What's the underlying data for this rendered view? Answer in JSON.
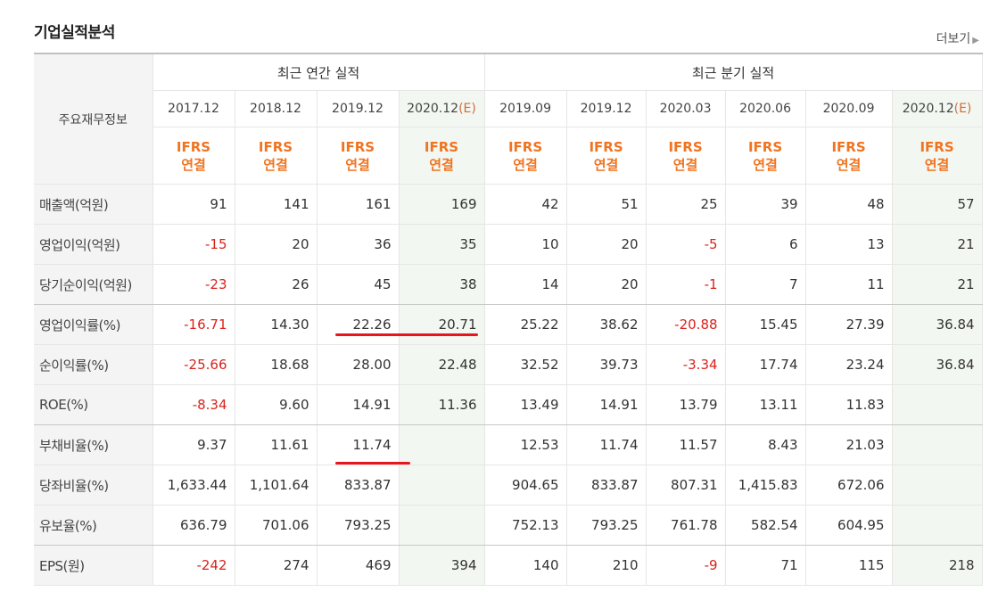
{
  "section_title": "기업실적분석",
  "more_link": "더보기",
  "header": {
    "row_header": "주요재무정보",
    "annual_group": "최근 연간 실적",
    "quarterly_group": "최근 분기 실적",
    "annual_dates": [
      "2017.12",
      "2018.12",
      "2019.12",
      "2020.12"
    ],
    "quarterly_dates": [
      "2019.09",
      "2019.12",
      "2020.03",
      "2020.06",
      "2020.09",
      "2020.12"
    ],
    "estimate_mark": "(E)",
    "ifrs_line1": "IFRS",
    "ifrs_line2": "연결"
  },
  "rows": [
    {
      "label": "매출액(억원)",
      "values": [
        "91",
        "141",
        "161",
        "169",
        "42",
        "51",
        "25",
        "39",
        "48",
        "57"
      ]
    },
    {
      "label": "영업이익(억원)",
      "values": [
        "-15",
        "20",
        "36",
        "35",
        "10",
        "20",
        "-5",
        "6",
        "13",
        "21"
      ]
    },
    {
      "label": "당기순이익(억원)",
      "values": [
        "-23",
        "26",
        "45",
        "38",
        "14",
        "20",
        "-1",
        "7",
        "11",
        "21"
      ]
    },
    {
      "label": "영업이익률(%)",
      "values": [
        "-16.71",
        "14.30",
        "22.26",
        "20.71",
        "25.22",
        "38.62",
        "-20.88",
        "15.45",
        "27.39",
        "36.84"
      ]
    },
    {
      "label": "순이익률(%)",
      "values": [
        "-25.66",
        "18.68",
        "28.00",
        "22.48",
        "32.52",
        "39.73",
        "-3.34",
        "17.74",
        "23.24",
        "36.84"
      ]
    },
    {
      "label": "ROE(%)",
      "values": [
        "-8.34",
        "9.60",
        "14.91",
        "11.36",
        "13.49",
        "14.91",
        "13.79",
        "13.11",
        "11.83",
        ""
      ]
    },
    {
      "label": "부채비율(%)",
      "values": [
        "9.37",
        "11.61",
        "11.74",
        "",
        "12.53",
        "11.74",
        "11.57",
        "8.43",
        "21.03",
        ""
      ]
    },
    {
      "label": "당좌비율(%)",
      "values": [
        "1,633.44",
        "1,101.64",
        "833.87",
        "",
        "904.65",
        "833.87",
        "807.31",
        "1,415.83",
        "672.06",
        ""
      ]
    },
    {
      "label": "유보율(%)",
      "values": [
        "636.79",
        "701.06",
        "793.25",
        "",
        "752.13",
        "793.25",
        "761.78",
        "582.54",
        "604.95",
        ""
      ]
    },
    {
      "label": "EPS(원)",
      "values": [
        "-242",
        "274",
        "469",
        "394",
        "140",
        "210",
        "-9",
        "71",
        "115",
        "218"
      ]
    }
  ],
  "colors": {
    "negative": "#d9221c",
    "ifrs": "#f07420",
    "estimate_bg": "#f3f7f1",
    "annotation": "#e8161c"
  }
}
